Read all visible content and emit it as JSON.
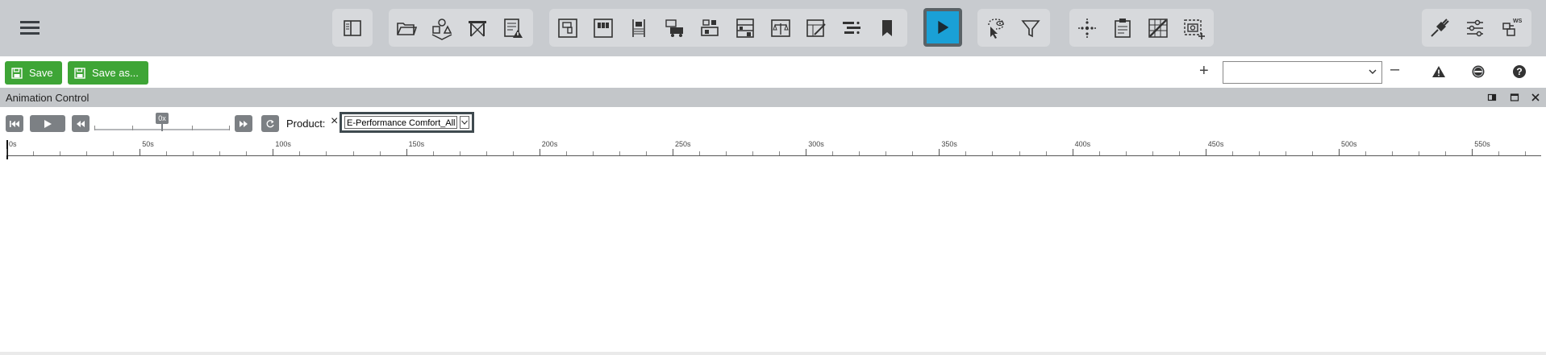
{
  "toolbar": {
    "groups": [
      {
        "name": "view",
        "buttons": [
          "panel-toggle-icon"
        ]
      },
      {
        "name": "project",
        "buttons": [
          "folder-open-icon",
          "shapes-icon",
          "rack-icon",
          "document-warning-icon"
        ]
      },
      {
        "name": "layout",
        "buttons": [
          "layout-icon",
          "columns-icon",
          "conveyor-icon",
          "vehicles-icon",
          "stations-icon",
          "shelf-icon",
          "balance-icon",
          "edit-grid-icon",
          "gantt-icon",
          "bookmark-icon"
        ]
      },
      {
        "name": "simulation",
        "buttons": [
          "play-icon"
        ]
      },
      {
        "name": "select",
        "buttons": [
          "lasso-eye-icon",
          "filter-icon"
        ]
      },
      {
        "name": "tools",
        "buttons": [
          "scatter-icon",
          "clipboard-icon",
          "grid-edit-icon",
          "screenshot-add-icon"
        ]
      },
      {
        "name": "system",
        "buttons": [
          "plugin-icon",
          "settings-sliders-icon",
          "workspace-icon"
        ]
      }
    ],
    "accent": "#1aa0d6",
    "workspace_badge": "WS"
  },
  "savebar": {
    "save_label": "Save",
    "save_as_label": "Save as...",
    "combo_value": "",
    "button_color": "#3ea536"
  },
  "panel": {
    "title": "Animation Control"
  },
  "animation": {
    "speed_label": "0x",
    "product_label": "Product:",
    "product_value": "E-Performance Comfort_All"
  },
  "timeline": {
    "labels": [
      "0s",
      "50s",
      "100s",
      "150s",
      "200s",
      "250s",
      "300s",
      "350s",
      "400s",
      "450s",
      "500s",
      "550s"
    ]
  }
}
